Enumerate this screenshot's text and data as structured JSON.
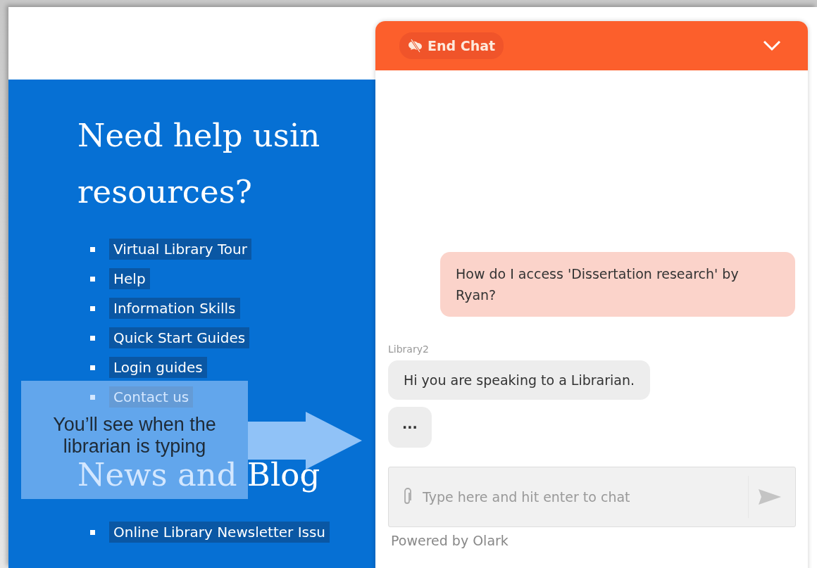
{
  "page": {
    "sections": [
      {
        "heading_lines": [
          "Need help usin",
          "resources?"
        ],
        "links": [
          "Virtual Library Tour",
          "Help",
          "Information Skills",
          "Quick Start Guides",
          "Login guides",
          "Contact us"
        ]
      },
      {
        "heading_lines": [
          "News and Blog"
        ],
        "links": [
          "Online Library Newsletter Issu"
        ]
      }
    ]
  },
  "callout": {
    "text": "You’ll see when the librarian is typing"
  },
  "chat": {
    "end_chat_button": "End Chat",
    "messages": [
      {
        "kind": "visitor",
        "text": "How do I access 'Dissertation research' by Ryan?"
      },
      {
        "kind": "operator",
        "sender": "Library2",
        "text": "Hi you are speaking to a Librarian."
      },
      {
        "kind": "typing",
        "text": "..."
      }
    ],
    "input": {
      "placeholder": "Type here and hit enter to chat"
    },
    "footer": "Powered by Olark"
  }
}
